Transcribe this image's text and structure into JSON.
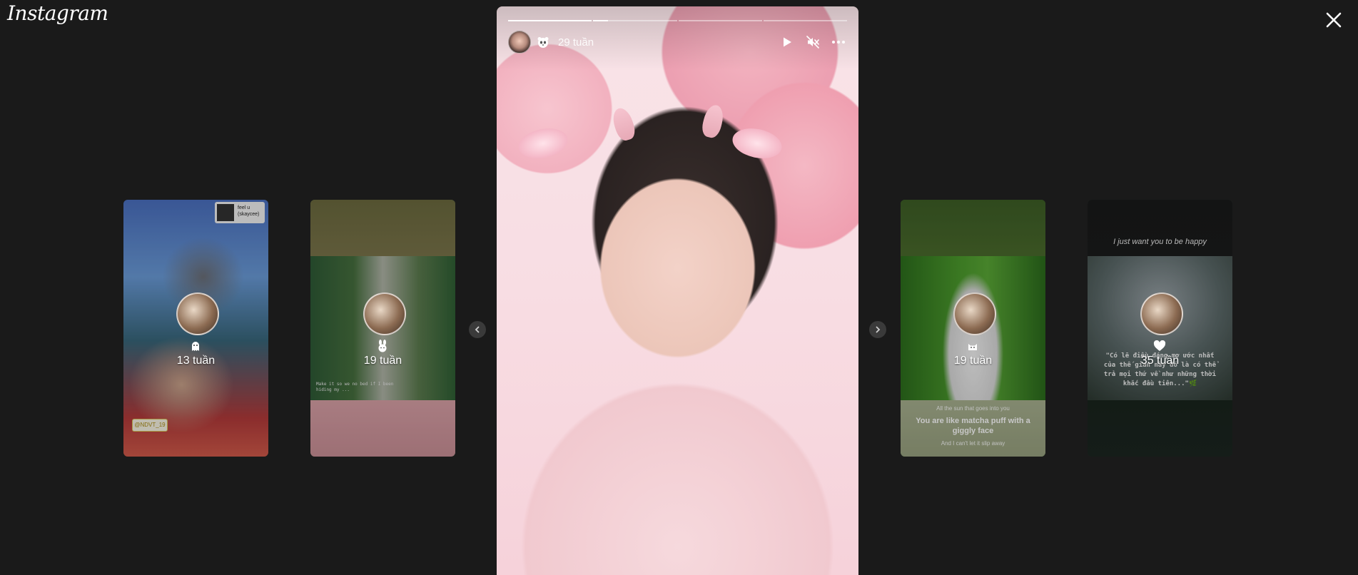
{
  "app": {
    "logo_text": "Instagram"
  },
  "header": {
    "close_icon": "close-icon"
  },
  "main_story": {
    "time_ago": "29 tuần",
    "segments": [
      1.0,
      0.18,
      0.0,
      0.0
    ],
    "icons": [
      "play-icon",
      "mute-icon",
      "more-icon"
    ]
  },
  "side_stories": [
    {
      "time_ago": "13 tuần",
      "sticker_icon": "ghost-emoji-icon",
      "music_tag": {
        "title": "feel u",
        "artist": "(skaycee)"
      },
      "mention_tag": "@NDVT_19"
    },
    {
      "time_ago": "19 tuần",
      "sticker_icon": "bunny-emoji-icon",
      "caption": "Make it so we no bed if I been hiding my ..."
    },
    {
      "time_ago": "19 tuần",
      "sticker_icon": "cat-emoji-icon",
      "caption_line1": "All the sun that goes into you",
      "caption_line2": "You are like matcha puff with a giggly face",
      "caption_line3": "And I can't let it slip away"
    },
    {
      "time_ago": "35 tuần",
      "sticker_icon": "heart-icon",
      "quote_top": "I just want you to be happy",
      "quote_body": "\"Có lẽ điều đáng mơ ước nhất của thế gian này đó là có thể trả mọi thứ về như những thời khắc đầu tiên...\"🌿"
    }
  ],
  "nav": {
    "prev_icon": "chevron-left-icon",
    "next_icon": "chevron-right-icon"
  }
}
